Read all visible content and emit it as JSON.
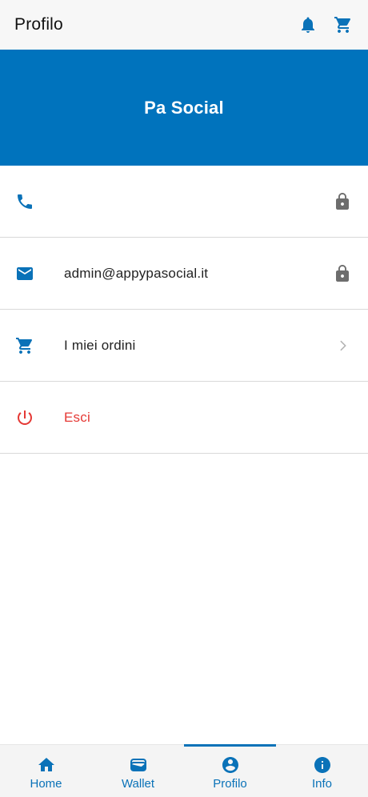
{
  "appbar": {
    "title": "Profilo",
    "actions": [
      {
        "icon": "bell-icon"
      },
      {
        "icon": "cart-icon"
      }
    ]
  },
  "banner": {
    "title": "Pa Social"
  },
  "profile_rows": [
    {
      "icon": "phone-icon",
      "text": "",
      "trailing": "lock-icon"
    },
    {
      "icon": "mail-icon",
      "text": "admin@appypasocial.it",
      "trailing": "lock-icon"
    },
    {
      "icon": "cart-icon",
      "text": "I miei ordini",
      "trailing": "chevron-right-icon"
    },
    {
      "icon": "power-icon",
      "text": "Esci",
      "trailing": ""
    }
  ],
  "bottom_nav": {
    "active_index": 2,
    "items": [
      {
        "label": "Home",
        "icon": "home-icon"
      },
      {
        "label": "Wallet",
        "icon": "wallet-icon"
      },
      {
        "label": "Profilo",
        "icon": "account-circle-icon"
      },
      {
        "label": "Info",
        "icon": "info-icon"
      }
    ]
  },
  "colors": {
    "primary": "#0073bd",
    "accent": "#0a72b8",
    "danger": "#e53935",
    "lock": "#6d6d6d"
  }
}
